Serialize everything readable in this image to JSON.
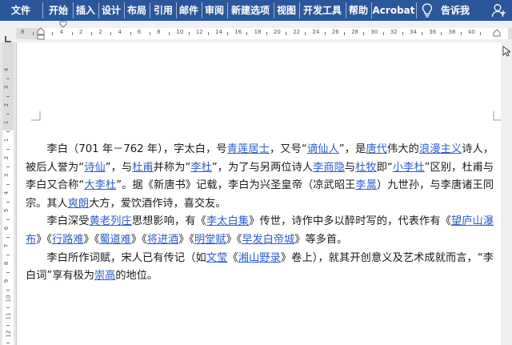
{
  "ribbon": {
    "tabs": [
      "文件",
      "开始",
      "插入",
      "设计",
      "布局",
      "引用",
      "邮件",
      "审阅",
      "新建选项",
      "视图",
      "开发工具",
      "帮助",
      "Acrobat"
    ],
    "tell_me": "告诉我",
    "bg_color": "#2b579a",
    "icons": [
      "lightbulb-icon",
      "share-person-icon"
    ]
  },
  "ruler": {
    "h_numbers": [
      "8",
      "6",
      "4",
      "2",
      "2",
      "4",
      "6",
      "8",
      "10",
      "12",
      "14",
      "16",
      "18",
      "20",
      "22",
      "24",
      "26",
      "28",
      "30",
      "32",
      "34",
      "36",
      "38",
      "40"
    ],
    "v_numbers": [
      "4",
      "3",
      "2",
      "1",
      "1",
      "2",
      "3",
      "4",
      "5",
      "6",
      "7",
      "8",
      "9",
      "10",
      "11",
      "12"
    ]
  },
  "document": {
    "paragraphs": [
      [
        {
          "t": "李白（701 年－762 年），字太白，号"
        },
        {
          "t": "青莲居士",
          "link": true
        },
        {
          "t": "，又号“"
        },
        {
          "t": "谪仙人",
          "link": true
        },
        {
          "t": "”，是"
        },
        {
          "t": "唐代",
          "link": true
        },
        {
          "t": "伟大的"
        },
        {
          "t": "浪漫主义",
          "link": true
        },
        {
          "t": "诗人，被后人誉为“"
        },
        {
          "t": "诗仙",
          "link": true
        },
        {
          "t": "”，与"
        },
        {
          "t": "杜甫",
          "link": true
        },
        {
          "t": "并称为“"
        },
        {
          "t": "李杜",
          "link": true
        },
        {
          "t": "”，为了与另两位诗人"
        },
        {
          "t": "李商隐",
          "link": true
        },
        {
          "t": "与"
        },
        {
          "t": "杜牧",
          "link": true
        },
        {
          "t": "即“"
        },
        {
          "t": "小李杜",
          "link": true
        },
        {
          "t": "”区别，杜甫与李白又合称“"
        },
        {
          "t": "大李杜",
          "link": true
        },
        {
          "t": "”。据《新唐书》记载，李白为兴圣皇帝（凉武昭王"
        },
        {
          "t": "李暠",
          "link": true
        },
        {
          "t": "）九世孙，与李唐诸王同宗。其人"
        },
        {
          "t": "爽朗",
          "link": true
        },
        {
          "t": "大方，爱饮酒作诗，喜交友。"
        }
      ],
      [
        {
          "t": "李白深受"
        },
        {
          "t": "黄老列庄",
          "link": true
        },
        {
          "t": "思想影响，有《"
        },
        {
          "t": "李太白集",
          "link": true
        },
        {
          "t": "》传世，诗作中多以醉时写的，代表作有《"
        },
        {
          "t": "望庐山瀑布",
          "link": true
        },
        {
          "t": "》《"
        },
        {
          "t": "行路难",
          "link": true
        },
        {
          "t": "》《"
        },
        {
          "t": "蜀道难",
          "link": true
        },
        {
          "t": "》《"
        },
        {
          "t": "将进酒",
          "link": true
        },
        {
          "t": "》《"
        },
        {
          "t": "明堂赋",
          "link": true
        },
        {
          "t": "》《"
        },
        {
          "t": "早发白帝城",
          "link": true
        },
        {
          "t": "》等多首。"
        }
      ],
      [
        {
          "t": "李白所作词赋，宋人已有传记（如"
        },
        {
          "t": "文莹",
          "link": true
        },
        {
          "t": "《"
        },
        {
          "t": "湘山野录",
          "link": true
        },
        {
          "t": "》卷上），就其开创意义及艺术成就而言，“李白词”享有极为"
        },
        {
          "t": "崇高",
          "link": true
        },
        {
          "t": "的地位。"
        }
      ]
    ],
    "link_color": "#2e5fc7"
  }
}
